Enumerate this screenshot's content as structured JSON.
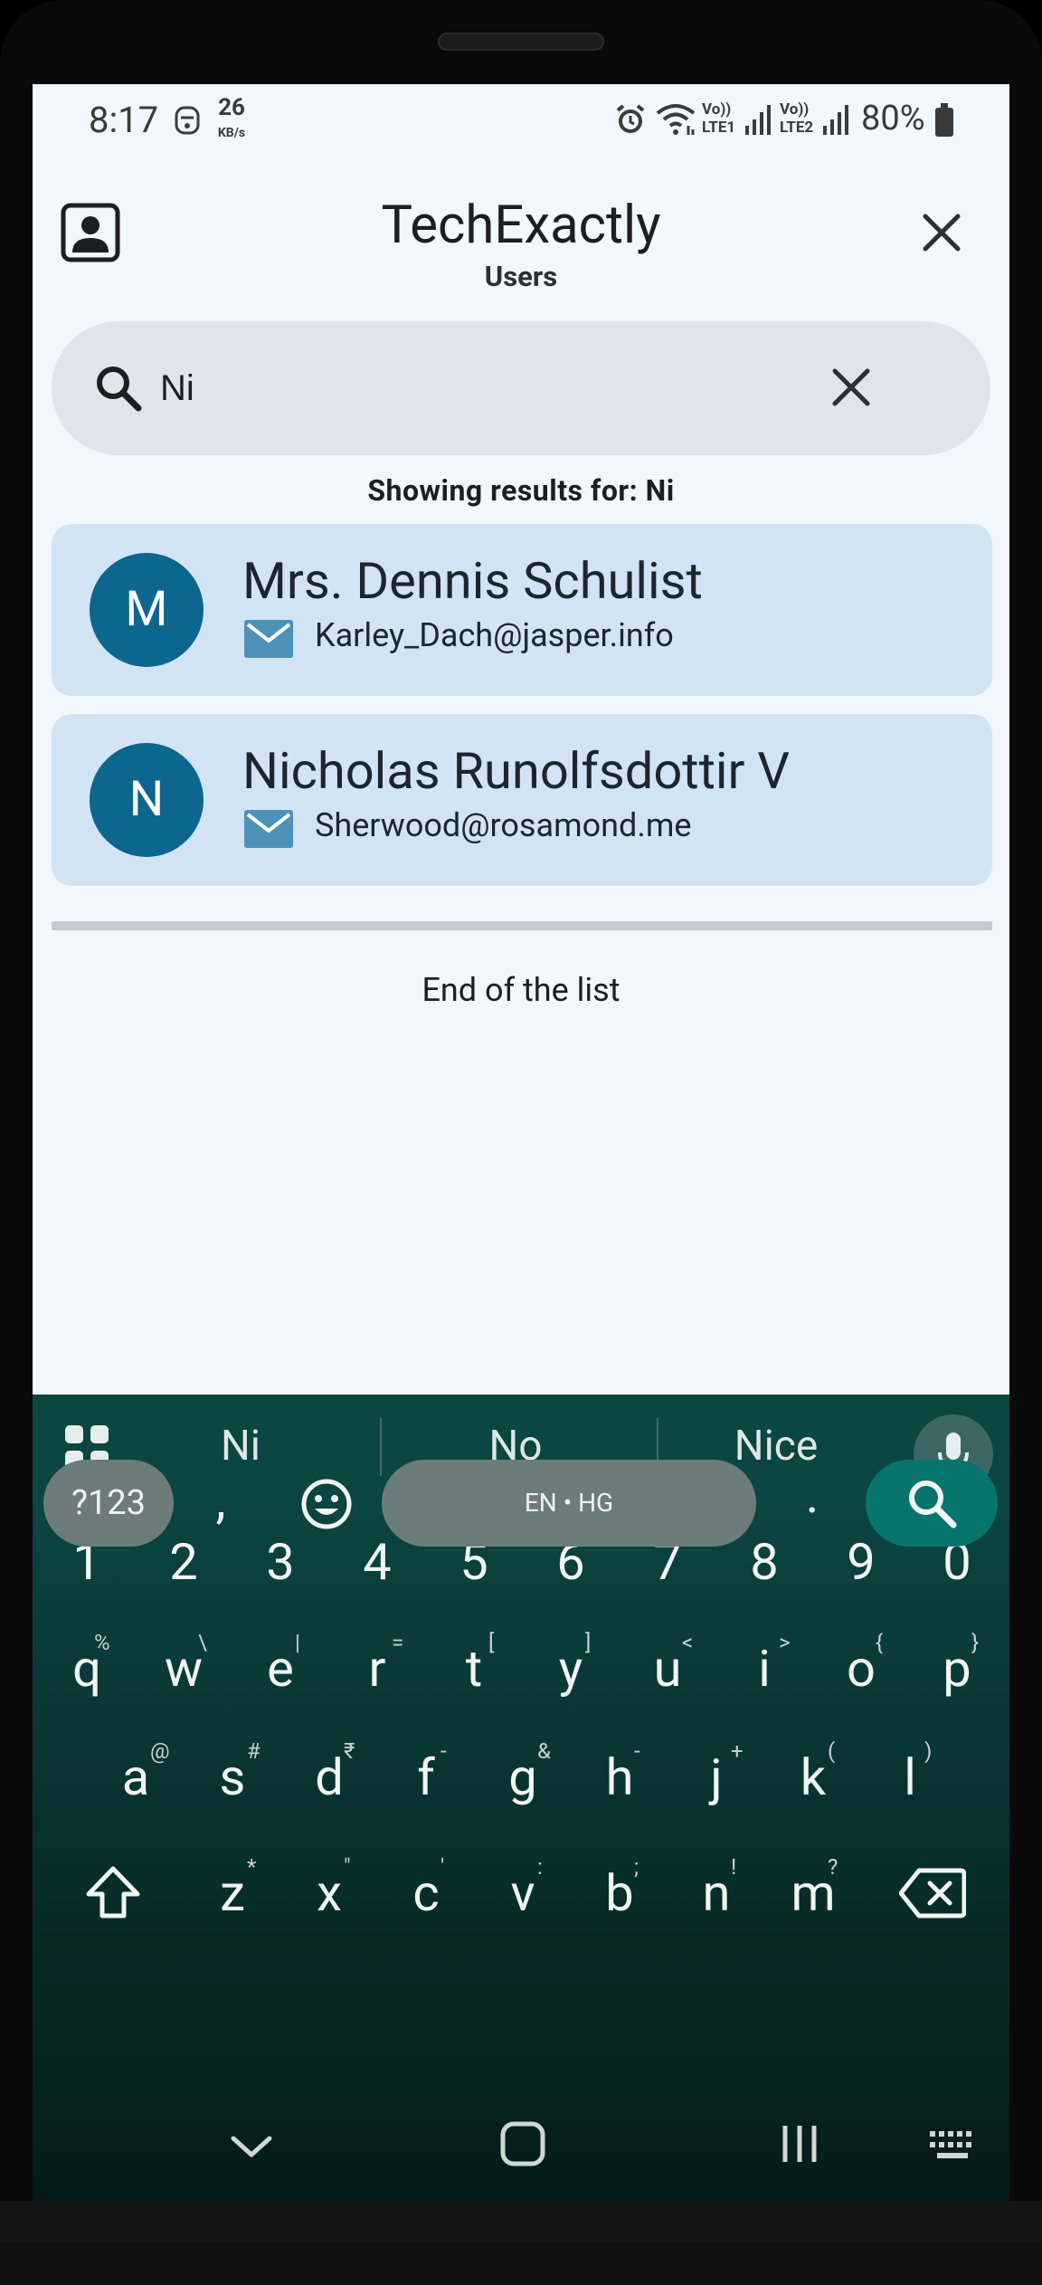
{
  "status_bar": {
    "time": "8:17",
    "data_speed": "26",
    "data_unit": "KB/s",
    "sim1_label": "LTE1",
    "sim2_label": "LTE2",
    "volte_label": "Vo))",
    "battery": "80%"
  },
  "header": {
    "title": "TechExactly",
    "subtitle": "Users"
  },
  "search": {
    "value": "Ni"
  },
  "results_label": "Showing results for: Ni",
  "users": [
    {
      "initial": "M",
      "name": "Mrs. Dennis Schulist",
      "email": "Karley_Dach@jasper.info"
    },
    {
      "initial": "N",
      "name": "Nicholas Runolfsdottir V",
      "email": "Sherwood@rosamond.me"
    }
  ],
  "end_label": "End of the list",
  "keyboard": {
    "suggestions": [
      "Ni",
      "No",
      "Nice"
    ],
    "numbers": [
      "1",
      "2",
      "3",
      "4",
      "5",
      "6",
      "7",
      "8",
      "9",
      "0"
    ],
    "row1": [
      {
        "k": "q",
        "h": "%"
      },
      {
        "k": "w",
        "h": "\\"
      },
      {
        "k": "e",
        "h": "|"
      },
      {
        "k": "r",
        "h": "="
      },
      {
        "k": "t",
        "h": "["
      },
      {
        "k": "y",
        "h": "]"
      },
      {
        "k": "u",
        "h": "<"
      },
      {
        "k": "i",
        "h": ">"
      },
      {
        "k": "o",
        "h": "{"
      },
      {
        "k": "p",
        "h": "}"
      }
    ],
    "row2": [
      {
        "k": "a",
        "h": "@"
      },
      {
        "k": "s",
        "h": "#"
      },
      {
        "k": "d",
        "h": "₹"
      },
      {
        "k": "f",
        "h": "-"
      },
      {
        "k": "g",
        "h": "&"
      },
      {
        "k": "h",
        "h": "-"
      },
      {
        "k": "j",
        "h": "+"
      },
      {
        "k": "k",
        "h": "("
      },
      {
        "k": "l",
        "h": ")"
      }
    ],
    "row3": [
      {
        "k": "z",
        "h": "*"
      },
      {
        "k": "x",
        "h": "\""
      },
      {
        "k": "c",
        "h": "'"
      },
      {
        "k": "v",
        "h": ":"
      },
      {
        "k": "b",
        "h": ";"
      },
      {
        "k": "n",
        "h": "!"
      },
      {
        "k": "m",
        "h": "?"
      }
    ],
    "symbols_label": "?123",
    "comma": ",",
    "space_label": "EN • HG",
    "period": "."
  },
  "colors": {
    "screen_bg": "#f1f7fc",
    "card_bg": "#d2e4f3",
    "avatar_bg": "#0c6690",
    "keyboard_bg": "#0b4641",
    "enter_key": "#07756b"
  }
}
